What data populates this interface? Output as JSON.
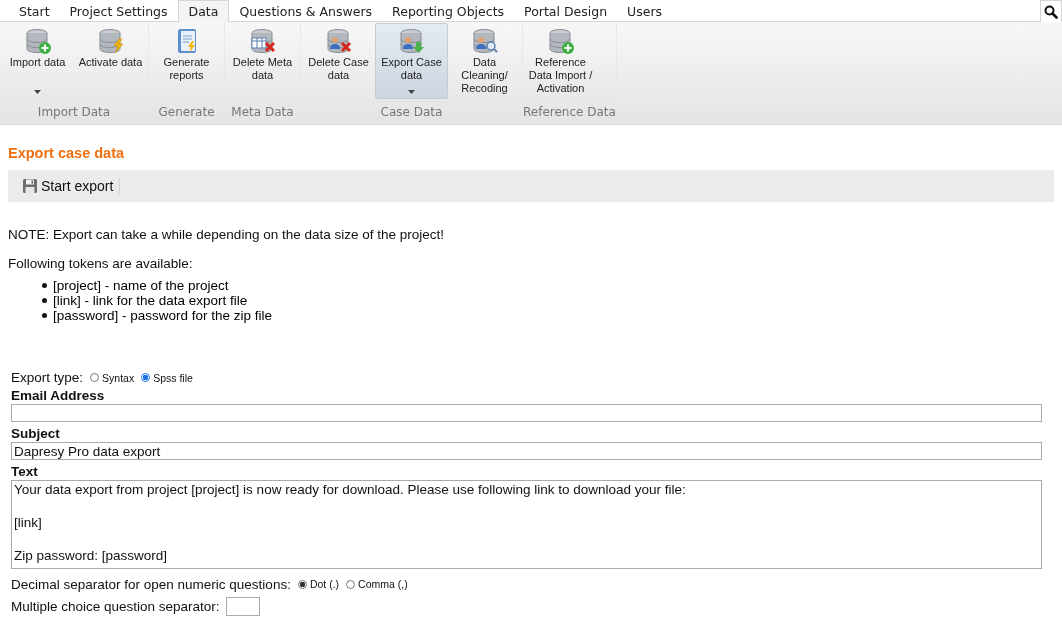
{
  "tabs": [
    {
      "label": "Start",
      "selected": false
    },
    {
      "label": "Project Settings",
      "selected": false
    },
    {
      "label": "Data",
      "selected": true
    },
    {
      "label": "Questions & Answers",
      "selected": false
    },
    {
      "label": "Reporting Objects",
      "selected": false
    },
    {
      "label": "Portal Design",
      "selected": false
    },
    {
      "label": "Users",
      "selected": false
    }
  ],
  "ribbon": [
    {
      "title": "Import Data",
      "buttons": [
        {
          "label": "Import data",
          "kind": "add",
          "dropdown": true,
          "selected": false
        },
        {
          "label": "Activate data",
          "kind": "activate",
          "dropdown": false,
          "selected": false
        }
      ]
    },
    {
      "title": "Generate",
      "buttons": [
        {
          "label": "Generate reports",
          "kind": "report",
          "dropdown": false,
          "selected": false
        }
      ]
    },
    {
      "title": "Meta Data",
      "buttons": [
        {
          "label": "Delete Meta data",
          "kind": "delete-table",
          "dropdown": false,
          "selected": false
        }
      ]
    },
    {
      "title": "Case Data",
      "buttons": [
        {
          "label": "Delete Case data",
          "kind": "delete-user",
          "dropdown": false,
          "selected": false
        },
        {
          "label": "Export Case data",
          "kind": "export-user",
          "dropdown": true,
          "selected": true
        },
        {
          "label": "Data Cleaning/ Recoding",
          "kind": "search-user",
          "dropdown": false,
          "selected": false
        }
      ]
    },
    {
      "title": "Reference Data",
      "buttons": [
        {
          "label": "Reference Data Import / Activation",
          "kind": "add",
          "dropdown": false,
          "selected": false
        }
      ]
    }
  ],
  "page": {
    "title": "Export case data",
    "toolbar": {
      "button": "Start export"
    },
    "note": "NOTE: Export can take a while depending on the data size of the project!",
    "tokens_intro": "Following tokens are available:",
    "tokens": [
      "[project] - name of the project",
      "[link] - link for the data export file",
      "[password] - password for the zip file"
    ]
  },
  "form": {
    "export_type": {
      "label": "Export type:",
      "options": [
        {
          "label": "Syntax",
          "selected": false
        },
        {
          "label": "Spss file",
          "selected": true
        }
      ]
    },
    "email": {
      "label": "Email Address"
    },
    "subject": {
      "label": "Subject",
      "value": "Dapresy Pro data export"
    },
    "text": {
      "label": "Text",
      "value": "Your data export from project [project] is now ready for download. Please use following link to download your file:\n\n[link]\n\nZip password: [password]"
    },
    "decimal_separator": {
      "label": "Decimal separator for open numeric questions:",
      "options": [
        {
          "label": "Dot (.)",
          "selected": true
        },
        {
          "label": "Comma (,)",
          "selected": false
        }
      ]
    },
    "mc_separator": {
      "label": "Multiple choice question separator:"
    }
  }
}
